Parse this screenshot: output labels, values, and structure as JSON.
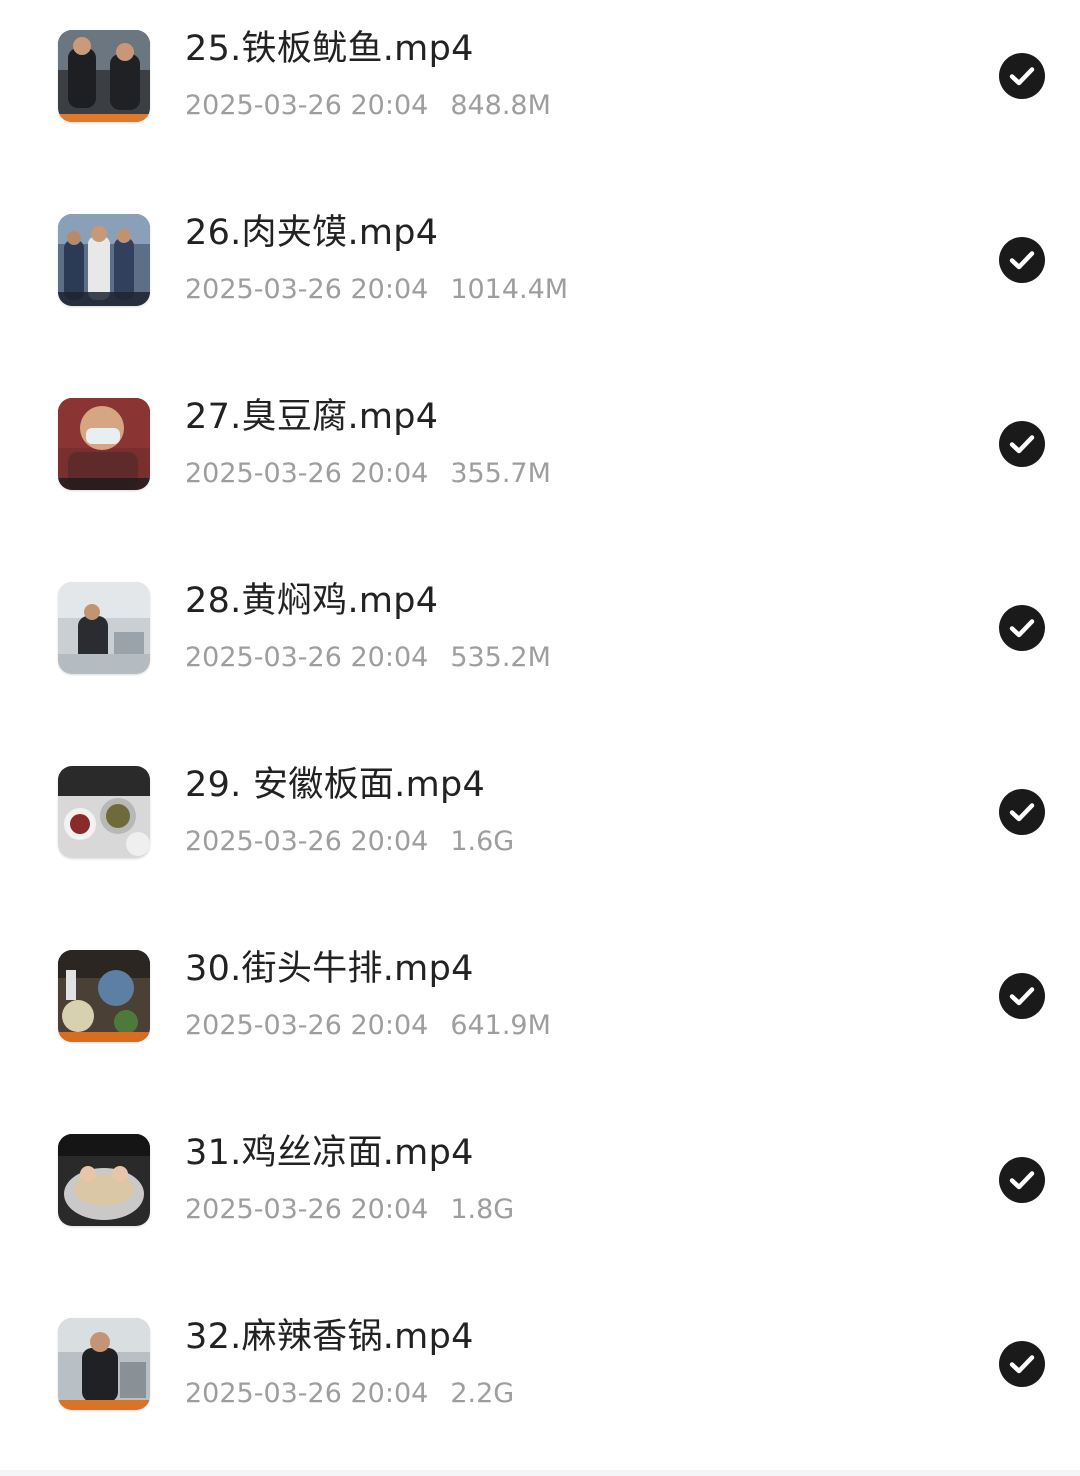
{
  "files": [
    {
      "name": "25.铁板鱿鱼.mp4",
      "date": "2025-03-26 20:04",
      "size": "848.8M",
      "thumb_icon": "video-thumbnail",
      "selected": true
    },
    {
      "name": "26.肉夹馍.mp4",
      "date": "2025-03-26 20:04",
      "size": "1014.4M",
      "thumb_icon": "video-thumbnail",
      "selected": true
    },
    {
      "name": "27.臭豆腐.mp4",
      "date": "2025-03-26 20:04",
      "size": "355.7M",
      "thumb_icon": "video-thumbnail",
      "selected": true
    },
    {
      "name": "28.黄焖鸡.mp4",
      "date": "2025-03-26 20:04",
      "size": "535.2M",
      "thumb_icon": "video-thumbnail",
      "selected": true
    },
    {
      "name": "29. 安徽板面.mp4",
      "date": "2025-03-26 20:04",
      "size": "1.6G",
      "thumb_icon": "video-thumbnail",
      "selected": true
    },
    {
      "name": "30.街头牛排.mp4",
      "date": "2025-03-26 20:04",
      "size": "641.9M",
      "thumb_icon": "video-thumbnail",
      "selected": true
    },
    {
      "name": "31.鸡丝凉面.mp4",
      "date": "2025-03-26 20:04",
      "size": "1.8G",
      "thumb_icon": "video-thumbnail",
      "selected": true
    },
    {
      "name": "32.麻辣香锅.mp4",
      "date": "2025-03-26 20:04",
      "size": "2.2G",
      "thumb_icon": "video-thumbnail",
      "selected": true
    }
  ],
  "colors": {
    "title_text": "#222222",
    "meta_text": "#9e9e9e",
    "check_fill": "#1a1a1a",
    "check_mark": "#ffffff"
  }
}
